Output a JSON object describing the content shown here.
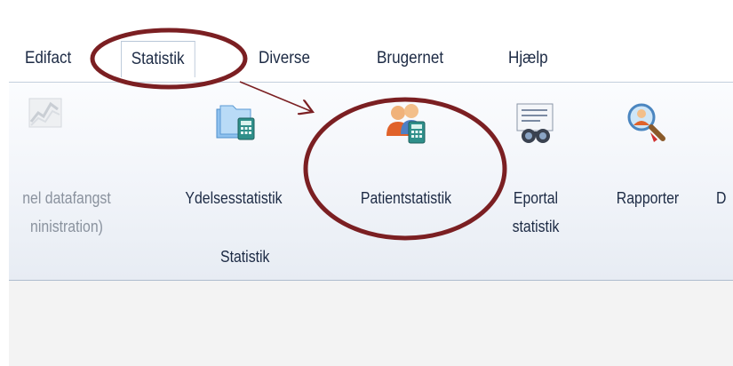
{
  "menu": {
    "tabs": [
      {
        "label": "Edifact"
      },
      {
        "label": "Statistik",
        "active": true
      },
      {
        "label": "Diverse"
      },
      {
        "label": "Brugernet"
      },
      {
        "label": "Hjælp"
      }
    ]
  },
  "ribbon": {
    "buttons": [
      {
        "line1": "nel datafangst",
        "line2": "ninistration)",
        "icon": "data-capture-chart-icon",
        "enabled": false
      },
      {
        "line1": "Ydelsesstatistik",
        "line2": "",
        "icon": "folders-calculator-icon",
        "enabled": true
      },
      {
        "line1": "Patientstatistik",
        "line2": "",
        "icon": "patients-calculator-icon",
        "enabled": true
      },
      {
        "line1": "Eportal",
        "line2": "statistik",
        "icon": "document-binoculars-icon",
        "enabled": true
      },
      {
        "line1": "Rapporter",
        "line2": "",
        "icon": "magnifier-person-icon",
        "enabled": true
      },
      {
        "line1": "D",
        "line2": "",
        "icon": "",
        "enabled": true
      }
    ],
    "group_label": "Statistik"
  },
  "annotation": {
    "color": "#7b1f22"
  }
}
